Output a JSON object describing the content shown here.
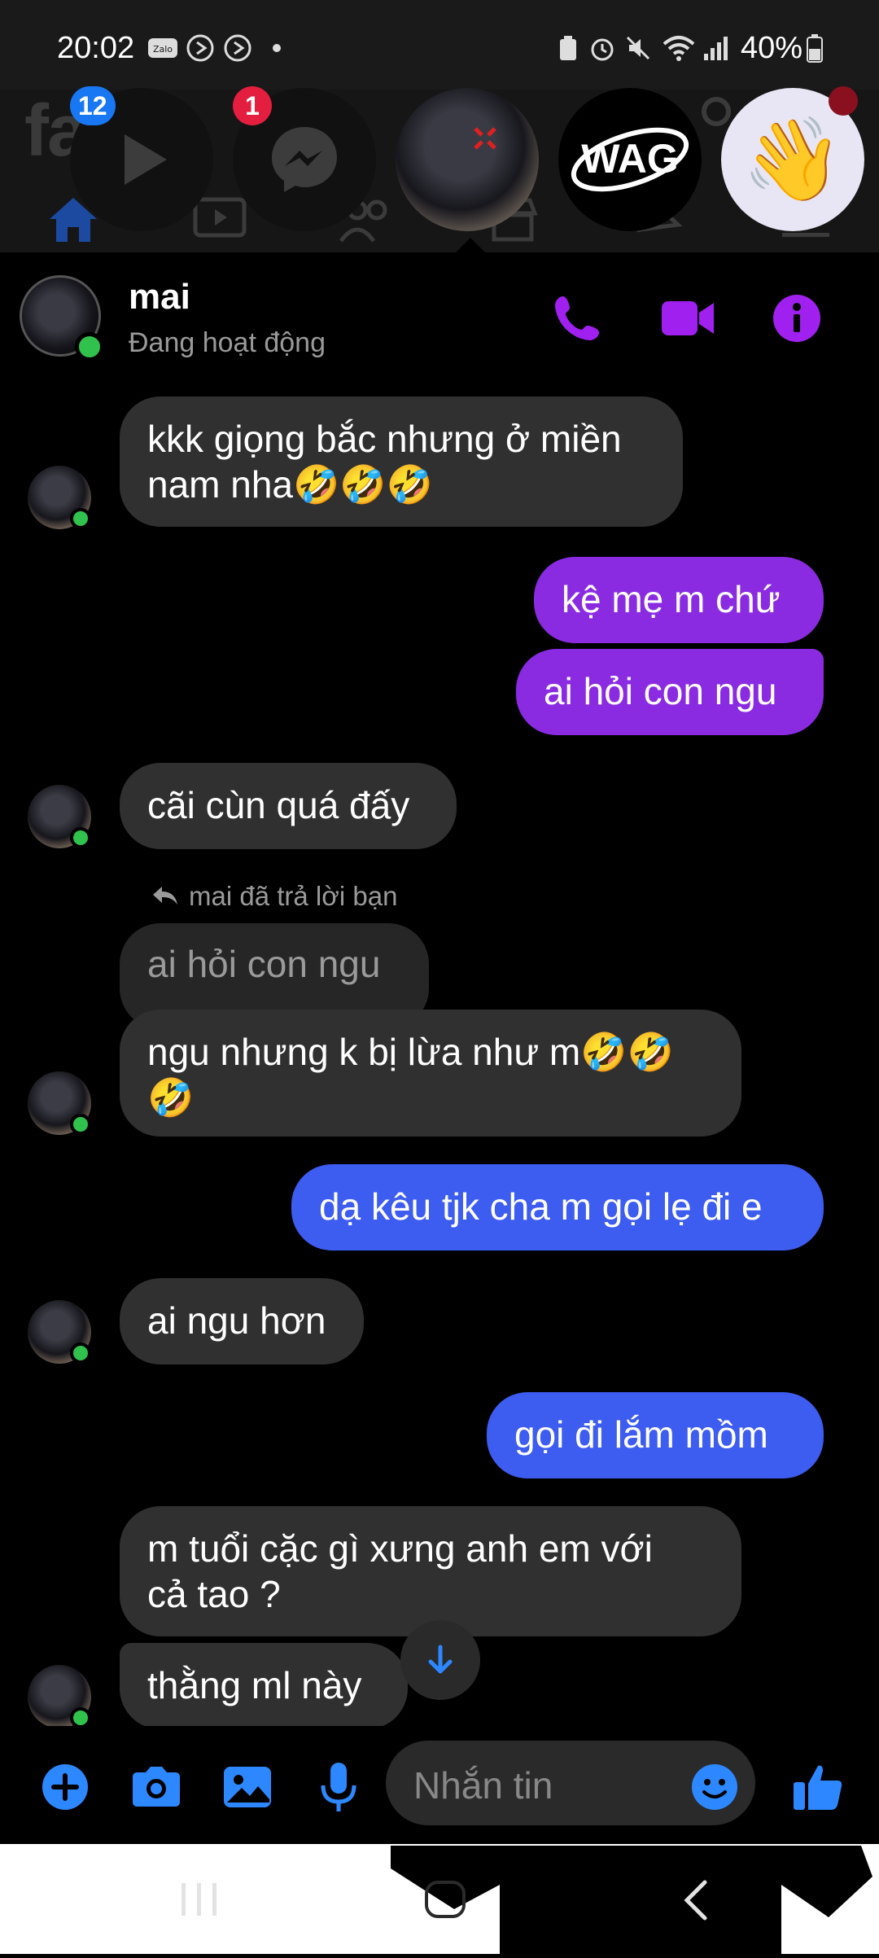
{
  "status_bar": {
    "time": "20:02",
    "battery": "40%",
    "icons": [
      "zalo-icon",
      "play-circle-icon",
      "play-circle-icon",
      "dot-icon",
      "recycle-icon",
      "alarm-icon",
      "mute-icon",
      "wifi-icon",
      "signal-icon",
      "battery-icon"
    ]
  },
  "chat_heads": [
    {
      "name": "watch-video",
      "badge": "12",
      "badge_color": "#1877f2"
    },
    {
      "name": "messenger",
      "badge": "1",
      "badge_color": "#e41e3f"
    },
    {
      "name": "mai-cat",
      "badge": ""
    },
    {
      "name": "wag",
      "label": "WAG",
      "badge": ""
    },
    {
      "name": "wave",
      "badge": ""
    }
  ],
  "conversation": {
    "name": "mai",
    "status": "Đang hoạt động"
  },
  "messages": [
    {
      "side": "in",
      "text": "kkk giọng bắc nhưng ở miền\nnam nha🤣🤣🤣"
    },
    {
      "side": "out",
      "color": "purple",
      "text": "kệ mẹ m chứ"
    },
    {
      "side": "out",
      "color": "purple",
      "text": "ai hỏi con ngu"
    },
    {
      "side": "in",
      "text": "cãi cùn quá đấy"
    },
    {
      "side": "in",
      "reply_note": "mai đã trả lời bạn",
      "quoted": "ai hỏi con ngu",
      "text": "ngu nhưng k bị lừa như m🤣🤣\n🤣"
    },
    {
      "side": "out",
      "color": "blue",
      "text": "dạ kêu tjk cha m gọi lẹ đi e"
    },
    {
      "side": "in",
      "text": "ai ngu hơn"
    },
    {
      "side": "out",
      "color": "blue",
      "text": "gọi đi lắm mồm"
    },
    {
      "side": "in",
      "text": "m tuổi cặc gì xưng anh em với\ncả tao ?"
    },
    {
      "side": "in",
      "text": "thằng ml này"
    }
  ],
  "composer": {
    "placeholder": "Nhắn tin",
    "icons": [
      "plus-icon",
      "camera-icon",
      "image-icon",
      "mic-icon",
      "emoji-icon",
      "like-icon"
    ]
  },
  "colors": {
    "accent": "#a020f0",
    "composer_icon": "#2d88ff",
    "purple_bubble": "#8a2be2",
    "blue_bubble": "#3d5cf0",
    "incoming_bubble": "#303030"
  }
}
